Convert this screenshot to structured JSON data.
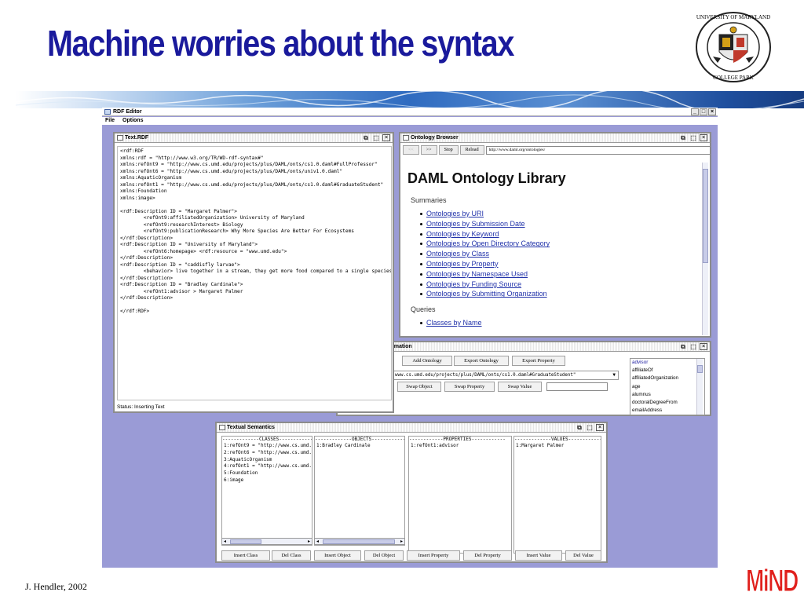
{
  "slide": {
    "title": "Machine worries about the syntax",
    "seal_text_top": "UNIVERSITY OF MARYLAND",
    "seal_text_bottom": "COLLEGE PARK",
    "credit": "J. Hendler, 2002",
    "logo": "MiND"
  },
  "app": {
    "title": "RDF Editor",
    "menu": [
      "File",
      "Options"
    ],
    "controls": [
      "_",
      "□",
      "×"
    ]
  },
  "text_rdf": {
    "title": "Text.RDF",
    "content": "<rdf:RDF\nxmlns:rdf = \"http://www.w3.org/TR/WD-rdf-syntax#\"\nxmlns:refOnt9 = \"http://www.cs.umd.edu/projects/plus/DAML/onts/cs1.0.daml#FullProfessor\"\nxmlns:refOnt6 = \"http://www.cs.umd.edu/projects/plus/DAML/onts/univ1.0.daml\"\nxmlns:AquaticOrganism\nxmlns:refOnt1 = \"http://www.cs.umd.edu/projects/plus/DAML/onts/cs1.0.daml#GraduateStudent\"\nxmlns:Foundation\nxmlns:image>\n\n<rdf:Description ID = \"Margaret Palmer\">\n        <refOnt9:affiliatedOrganization> University of Maryland\n        <refOnt9:researchInterest> Biology\n        <refOnt9:publicationResearch> Why More Species Are Better For Ecosystems\n</rdf:Description>\n<rdf:Description ID = \"University of Maryland\">\n        <refOnt6:homepage> <rdf:resource = \"www.umd.edu\">\n</rdf:Description>\n<rdf:Description ID = \"caddisfly larvae\">\n        <behavior> live together in a stream, they get more food compared to a single species\n</rdf:Description>\n<rdf:Description ID = \"Bradley Cardinale\">\n        <refOnt1:advisor > Margaret Palmer\n</rdf:Description>\n\n</rdf:RDF>",
    "status": "Status: Inserting Text"
  },
  "browser": {
    "title": "Ontology Browser",
    "back": "<<",
    "forward": ">>",
    "stop": "Stop",
    "reload": "Reload",
    "url": "http://www.daml.org/ontologies/",
    "heading": "DAML Ontology Library",
    "summaries_label": "Summaries",
    "summaries": [
      "Ontologies by URI",
      "Ontologies by Submission Date",
      "Ontologies by Keyword",
      "Ontologies by Open Directory Category",
      "Ontologies by Class",
      "Ontologies by Property",
      "Ontologies by Namespace Used",
      "Ontologies by Funding Source",
      "Ontologies by Submitting Organization"
    ],
    "queries_label": "Queries",
    "queries": [
      "Classes by Name"
    ]
  },
  "info": {
    "title": "rmation",
    "add_ontology": "Add Ontology",
    "export_ontology": "Export Ontology",
    "export_property": "Export Property",
    "combo_value": "www.cs.umd.edu/projects/plus/DAML/onts/cs1.0.daml#GraduateStudent\"",
    "swap_object": "Swap Object",
    "swap_property": "Swap Property",
    "swap_value": "Swap Value",
    "properties": [
      "advisor",
      "affiliateOf",
      "affiliatedOrganization",
      "age",
      "alumnus",
      "doctoralDegreeFrom",
      "emailAddress"
    ]
  },
  "semantics": {
    "title": "Textual Semantics",
    "classes_header": "-------------CLASSES-------------",
    "classes": [
      "1:refOnt9 = \"http://www.cs.umd.ed",
      "2:refOnt6 = \"http://www.cs.umd.ed",
      "3:AquaticOrganism",
      "4:refOnt1 = \"http://www.cs.umd.ed",
      "5:Foundation",
      "6:image"
    ],
    "objects_header": "-------------OBJECTS-------------",
    "objects": [
      "1:Bradley Cardinale"
    ],
    "properties_header": "------------PROPERTIES------------",
    "properties": [
      "1:refOnt1:advisor"
    ],
    "values_header": "-------------VALUES--------------",
    "values": [
      "1:Margaret Palmer"
    ],
    "buttons": {
      "insert_class": "Insert Class",
      "del_class": "Del Class",
      "insert_object": "Insert Object",
      "del_object": "Del Object",
      "insert_property": "Insert Property",
      "del_property": "Del Property",
      "insert_value": "Insert Value",
      "del_value": "Del Value"
    }
  }
}
